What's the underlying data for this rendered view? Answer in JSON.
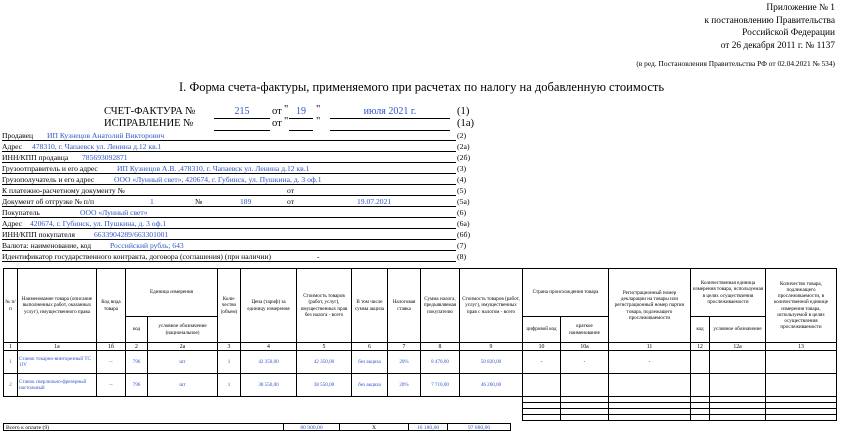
{
  "appendix": {
    "line1": "Приложение № 1",
    "line2": "к постановлению Правительства",
    "line3": "Российской Федерации",
    "line4": "от 26 декабря 2011 г. № 1137"
  },
  "redaction": "(в ред. Постановления Правительства РФ от 02.04.2021 № 534)",
  "title": "I. Форма счета-фактуры, применяемого при расчетах по налогу на добавленную стоимость",
  "invoice": {
    "label": "СЧЕТ-ФАКТУРА №",
    "number": "215",
    "from": "от",
    "q1": "\"",
    "day": "19",
    "q2": "\"",
    "month_year": "июля 2021 г.",
    "code": "(1)"
  },
  "correction": {
    "label": "ИСПРАВЛЕНИЕ №",
    "from": "от",
    "q1": "\"",
    "q2": "\"",
    "code": "(1а)"
  },
  "header_lines": [
    {
      "label": "Продавец",
      "value": "ИП Кузнецов Анатолий Викторович",
      "code": "(2)"
    },
    {
      "label": "Адрес",
      "value": "478310, г. Чапаевск ул. Ленина д.12 кв.1",
      "code": "(2а)"
    },
    {
      "label": "ИНН/КПП продавца",
      "value": "785693092871",
      "code": "(2б)"
    },
    {
      "label": "Грузоотправитель и его адрес",
      "value": "ИП Кузнецов А.В. ,478310, г. Чапаевск ул. Ленина д.12 кв.1",
      "code": "(3)"
    },
    {
      "label": "Грузополучатель и его адрес",
      "value": "ООО «Лунный свет», 420674, г. Губинск, ул. Пушкина, д. 3 оф.1",
      "code": "(4)"
    },
    {
      "label": "К платежно-расчетному документу №",
      "value": "",
      "code": "(5)"
    },
    {
      "label": "Документ об отгрузке № п/п",
      "value": "",
      "code": "(5а)"
    },
    {
      "label": "Покупатель",
      "value": "ООО «Лунный свет»",
      "code": "(6)"
    },
    {
      "label": "Адрес",
      "value": "420674, г. Губинск, ул. Пушкина, д. 3 оф.1",
      "code": "(6а)"
    },
    {
      "label": "ИНН/КПП покупателя",
      "value": "6633904289/663301001",
      "code": "(6б)"
    },
    {
      "label": "Валюта: наименование, код",
      "value": "Российский рубль; 643",
      "code": "(7)"
    },
    {
      "label": "Идентификатор государственного контракта, договора (соглашения) (при наличии)",
      "value": "-",
      "code": "(8)"
    }
  ],
  "pay_doc_from": "от",
  "ship_doc": {
    "pos": "1",
    "num_label": "№",
    "num": "189",
    "from": "от",
    "date": "19.07.2021"
  },
  "table": {
    "headers": {
      "no": "№ п/п",
      "name": "Наименование товара (описание выполненных работ, оказанных услуг), имущественного права",
      "type_code": "Код вида товара",
      "unit": "Единица измерения",
      "unit_code": "код",
      "unit_name": "условное обозначение (национальное)",
      "qty": "Коли-чество (объем)",
      "price": "Цена (тариф) за единицу измерения",
      "cost_wo_tax": "Стоимость товаров (работ, услуг), имущественных прав без налога - всего",
      "excise": "В том числе сумма акциза",
      "rate": "Налоговая ставка",
      "tax_sum": "Сумма налога, предъявляемая покупателю",
      "cost_w_tax": "Стоимость товаров (работ, услуг), имущественных прав с налогом - всего",
      "country": "Страна происхождения товара",
      "country_code": "цифровой код",
      "country_name": "краткое наименование",
      "decl": "Регистрационный номер декларации на товары или регистрационный номер партии товара, подлежащего прослеживаемости",
      "trace_unit": "Количественная единица измерения товара, используемая в целях осуществления прослеживаемости",
      "trace_code": "код",
      "trace_name": "условное обозначение",
      "trace_qty": "Количество товара, подлежащего прослеживаемости, в количественной единице измерения товара, используемой в целях осуществления прослеживаемости"
    },
    "index_row": [
      "1",
      "1а",
      "1б",
      "2",
      "2а",
      "3",
      "4",
      "5",
      "6",
      "7",
      "8",
      "9",
      "10",
      "10а",
      "11",
      "12",
      "12а",
      "13"
    ],
    "rows": [
      {
        "no": "1",
        "name": "Станок токарно-винторезный ТС 1IV",
        "type_code": "--",
        "unit_code": "796",
        "unit_name": "шт",
        "qty": "1",
        "price": "42 350,00",
        "cost": "42 350,00",
        "excise": "без акциза",
        "rate": "20%",
        "tax": "8 470,00",
        "total": "50 820,00",
        "cc": "-",
        "cn": "-",
        "decl": "-"
      },
      {
        "no": "2",
        "name": "Станок сверлильно-фрезерный настольный",
        "type_code": "--",
        "unit_code": "796",
        "unit_name": "шт",
        "qty": "1",
        "price": "38 550,00",
        "cost": "38 550,00",
        "excise": "без акциза",
        "rate": "20%",
        "tax": "7 710,00",
        "total": "46 260,00",
        "cc": "",
        "cn": "",
        "decl": ""
      }
    ],
    "total_label": "Всего к оплате (9)",
    "total_cost": "80 900,00",
    "total_x": "Х",
    "total_tax": "16 180,00",
    "total_sum": "97 080,00"
  }
}
